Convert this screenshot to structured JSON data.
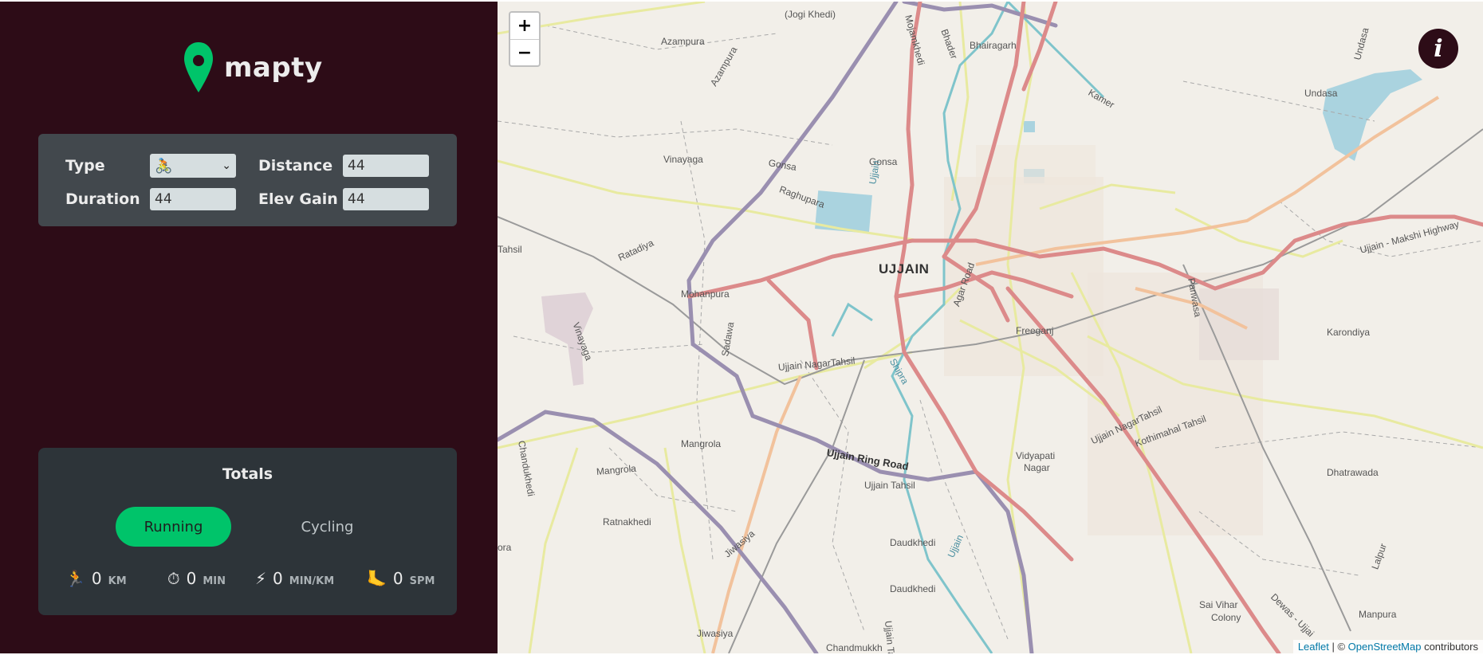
{
  "app": {
    "name": "mapty"
  },
  "form": {
    "type_label": "Type",
    "type_value": "🚴",
    "distance_label": "Distance",
    "distance_value": "44",
    "duration_label": "Duration",
    "duration_value": "44",
    "elev_label": "Elev Gain",
    "elev_value": "44"
  },
  "totals": {
    "title": "Totals",
    "tabs": [
      {
        "label": "Running",
        "active": true
      },
      {
        "label": "Cycling",
        "active": false
      }
    ],
    "stats": [
      {
        "icon": "🏃",
        "value": "0",
        "unit": "KM"
      },
      {
        "icon": "⏱",
        "value": "0",
        "unit": "MIN"
      },
      {
        "icon": "⚡",
        "value": "0",
        "unit": "MIN/KM"
      },
      {
        "icon": "🦶",
        "value": "0",
        "unit": "SPM"
      }
    ]
  },
  "map": {
    "zoom_in": "+",
    "zoom_out": "−",
    "info": "i",
    "attribution": {
      "leaflet": "Leaflet",
      "sep": " | © ",
      "osm": "OpenStreetMap",
      "suffix": " contributors"
    },
    "labels": {
      "city": "UJJAIN",
      "jogi_khedi": "(Jogi Khedi)",
      "azampura1": "Azampura",
      "azampura2": "Azampura",
      "bhairagarh": "Bhairagarh",
      "kamer": "Kamer",
      "undasa": "Undasa",
      "undasa_road": "Undasa",
      "vinayaga": "Vinayaga",
      "gonsa": "Gonsa",
      "gonsa2": "Gonsa",
      "raghupara": "Raghupara",
      "ratadiya": "Ratadiya",
      "tahsil": "Tahsil",
      "mohanpura": "Mohanpura",
      "vinayaga2": "Vinayaga",
      "sadawa": "Sadawa",
      "nagar_tahsil": "Ujjain NagarTahsil",
      "shipra": "Shipra",
      "freeganj": "Freeganj",
      "agar_road": "Agar Road",
      "panwasa": "Panwasa",
      "karondiya": "Karondiya",
      "highway": "Ujjain - Makshi Highway",
      "mangrola": "Mangrola",
      "mangrola2": "Mangrola",
      "chandukhedi": "Chandukhedi",
      "ring_road": "Ujjain Ring Road",
      "ujjain_tahsil": "Ujjain Tahsil",
      "vidyapati": "Vidyapati",
      "nagar": "Nagar",
      "ujjain_nagar_tahsil2": "Ujjain NagarTahsil",
      "kothimahal": "Kothimahal Tahsil",
      "dhatrawada": "Dhatrawada",
      "ratnakhedi": "Ratnakhedi",
      "jiwasiya": "Jiwasiya",
      "jiwasiya2": "Jiwasiya",
      "daudkhedi": "Daudkhedi",
      "daudkhedi2": "Daudkhedi",
      "ujjain_river": "Ujjain",
      "ujjain_river2": "Ujjain",
      "sai_vihar": "Sai Vihar",
      "colony": "Colony",
      "dewas": "Dewas - Ujjai",
      "manpura": "Manpura",
      "lalpur": "Lalpur",
      "bhader": "Bhader",
      "mojamkhedi": "Mojamkhedi",
      "chandmukh": "Chandmukkh",
      "ujjain_ta": "Ujjain Ta",
      "ora": "ora"
    }
  }
}
